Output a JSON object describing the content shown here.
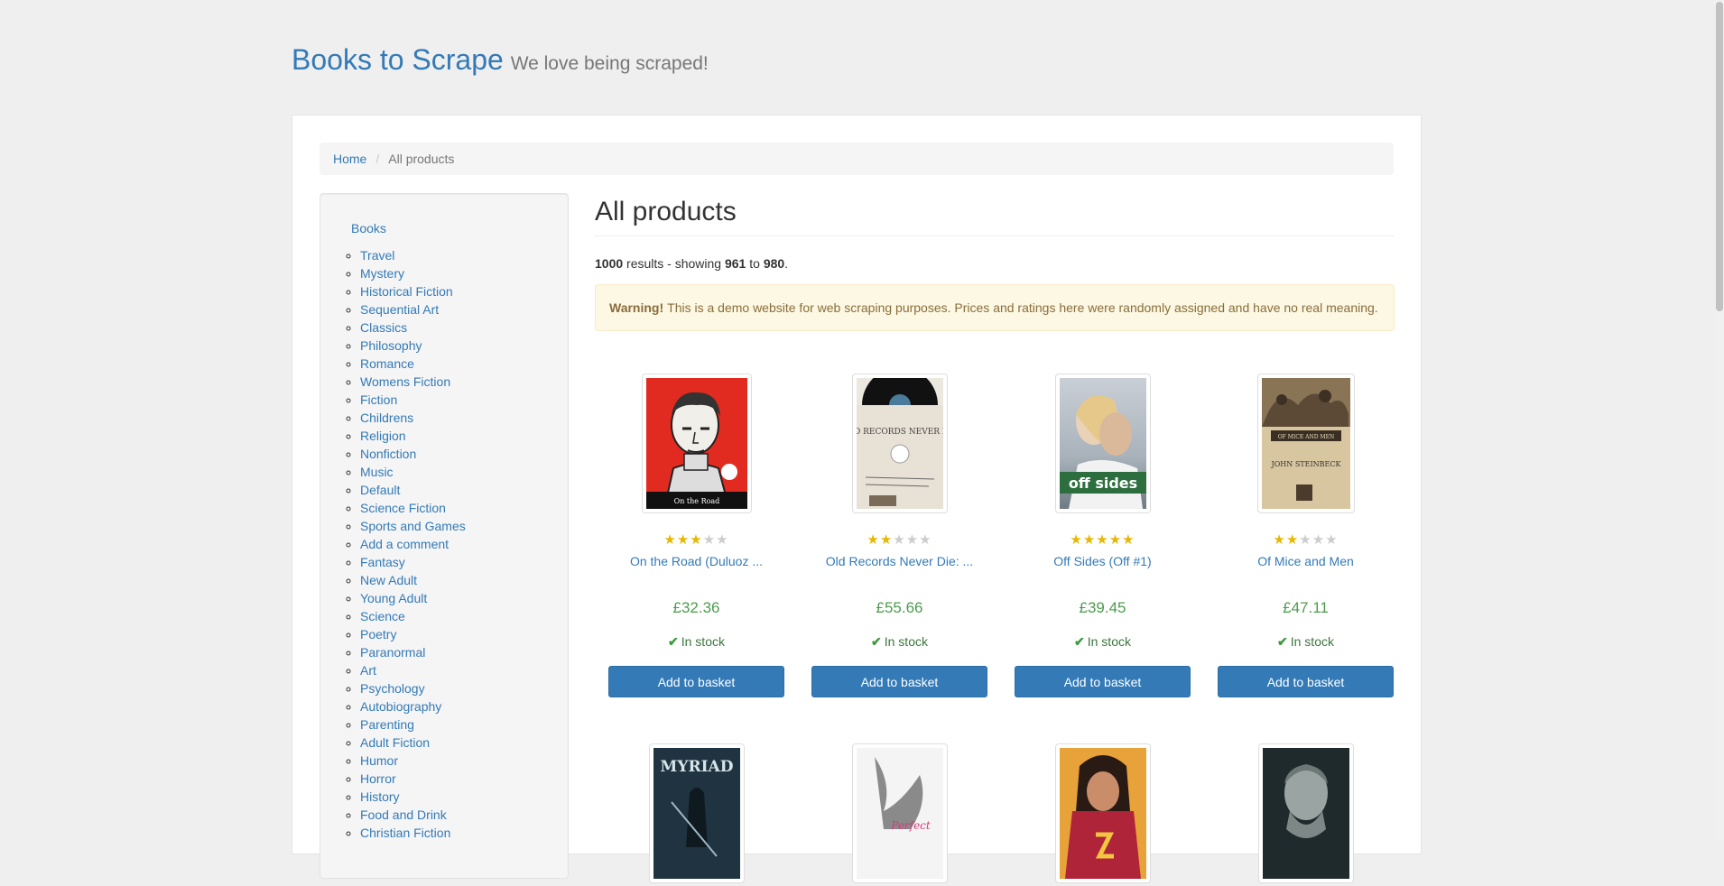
{
  "header": {
    "brand": "Books to Scrape",
    "tagline": "We love being scraped!"
  },
  "breadcrumb": {
    "home": "Home",
    "current": "All products"
  },
  "sidebar": {
    "root_label": "Books",
    "categories": [
      "Travel",
      "Mystery",
      "Historical Fiction",
      "Sequential Art",
      "Classics",
      "Philosophy",
      "Romance",
      "Womens Fiction",
      "Fiction",
      "Childrens",
      "Religion",
      "Nonfiction",
      "Music",
      "Default",
      "Science Fiction",
      "Sports and Games",
      "Add a comment",
      "Fantasy",
      "New Adult",
      "Young Adult",
      "Science",
      "Poetry",
      "Paranormal",
      "Art",
      "Psychology",
      "Autobiography",
      "Parenting",
      "Adult Fiction",
      "Humor",
      "Horror",
      "History",
      "Food and Drink",
      "Christian Fiction"
    ]
  },
  "main": {
    "title": "All products",
    "results": {
      "total": "1000",
      "text1": " results - showing ",
      "from": "961",
      "text2": " to ",
      "to": "980",
      "text3": "."
    },
    "warning": {
      "label": "Warning!",
      "text": "This is a demo website for web scraping purposes. Prices and ratings here were randomly assigned and have no real meaning."
    }
  },
  "basket_label": "Add to basket",
  "products": [
    {
      "title": "On the Road (Duluoz ...",
      "rating": 3,
      "price": "£32.36",
      "stock": "In stock",
      "cover": "on-the-road-cover"
    },
    {
      "title": "Old Records Never Die: ...",
      "rating": 2,
      "price": "£55.66",
      "stock": "In stock",
      "cover": "old-records-cover"
    },
    {
      "title": "Off Sides (Off #1)",
      "rating": 5,
      "price": "£39.45",
      "stock": "In stock",
      "cover": "off-sides-cover"
    },
    {
      "title": "Of Mice and Men",
      "rating": 2,
      "price": "£47.11",
      "stock": "In stock",
      "cover": "of-mice-and-men-cover"
    }
  ],
  "cover_texts": {
    "on_the_road": "On the Road",
    "old_records": "OLD RECORDS NEVER DIE",
    "off_sides": "off sides",
    "mice_title": "OF MICE AND MEN",
    "mice_author": "JOHN STEINBECK",
    "myriad": "MYRIAD",
    "perfect": "Perfect"
  },
  "colors": {
    "accent": "#337ab7",
    "price": "#4d9c4d",
    "star": "#e6b800",
    "warning_bg": "#fcf8e3"
  }
}
